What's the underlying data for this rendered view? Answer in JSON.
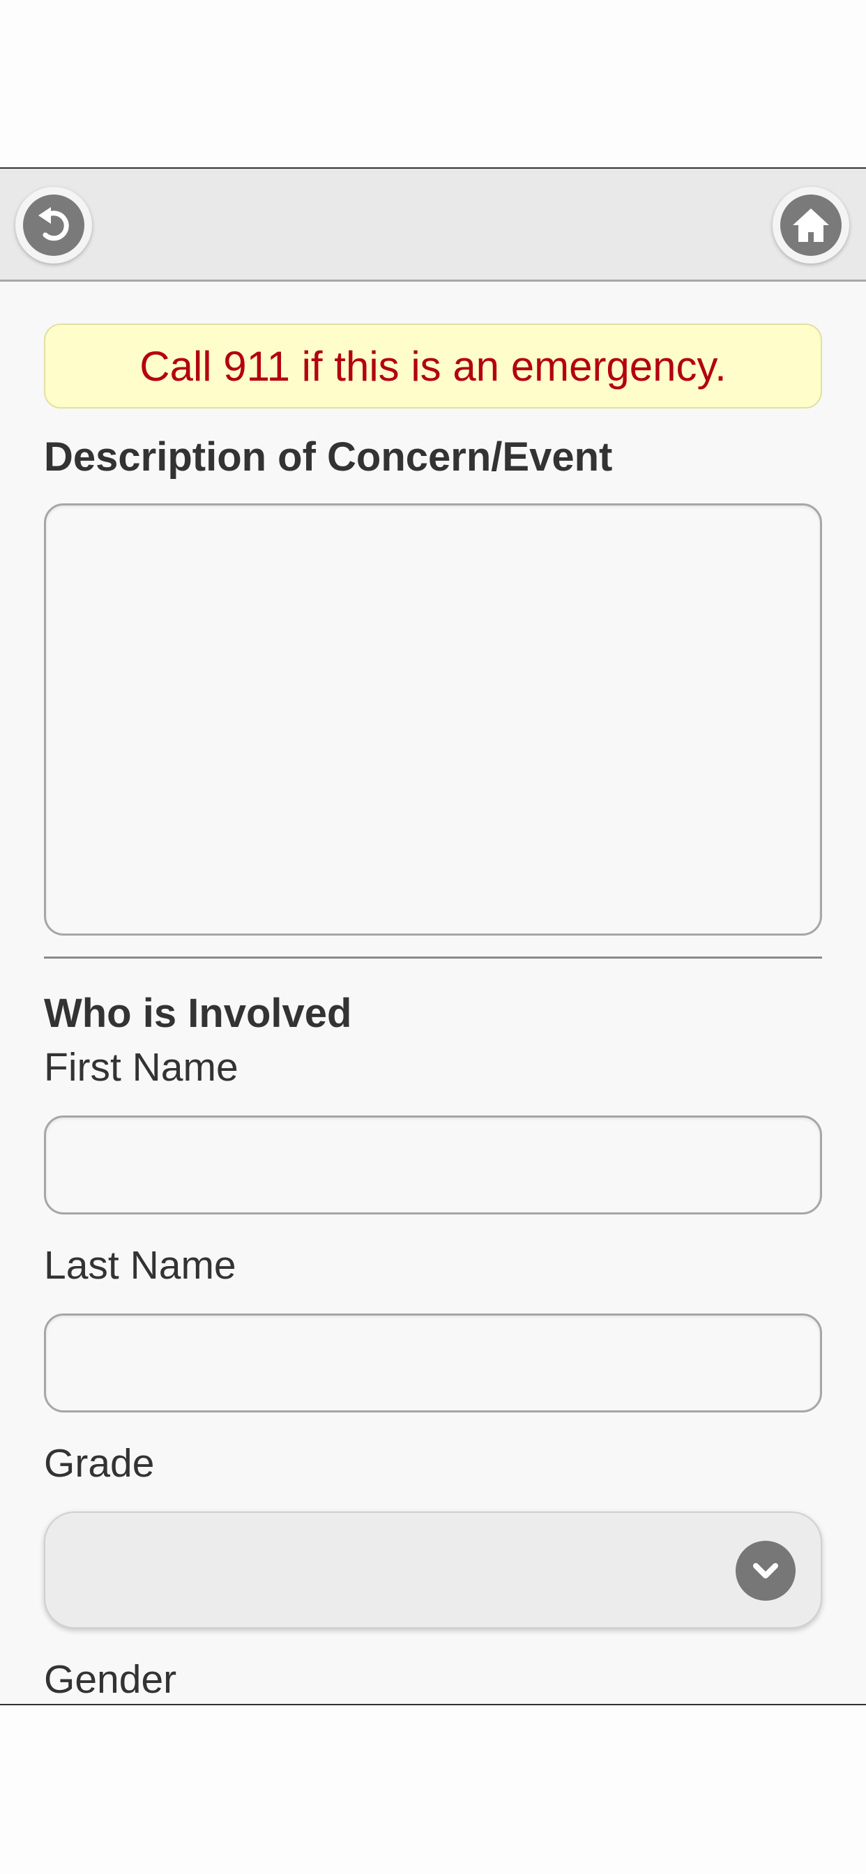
{
  "header": {
    "back_icon": "back-arrow-icon",
    "home_icon": "home-icon"
  },
  "alert": {
    "text": "Call 911 if this is an emergency.",
    "background_color": "#fffdc9",
    "text_color": "#b20010"
  },
  "description": {
    "heading": "Description of Concern/Event",
    "value": ""
  },
  "involved": {
    "heading": "Who is Involved",
    "first_name_label": "First Name",
    "first_name_value": "",
    "last_name_label": "Last Name",
    "last_name_value": "",
    "grade_label": "Grade",
    "grade_value": "",
    "grade_chevron_icon": "chevron-down-icon",
    "gender_label": "Gender"
  }
}
